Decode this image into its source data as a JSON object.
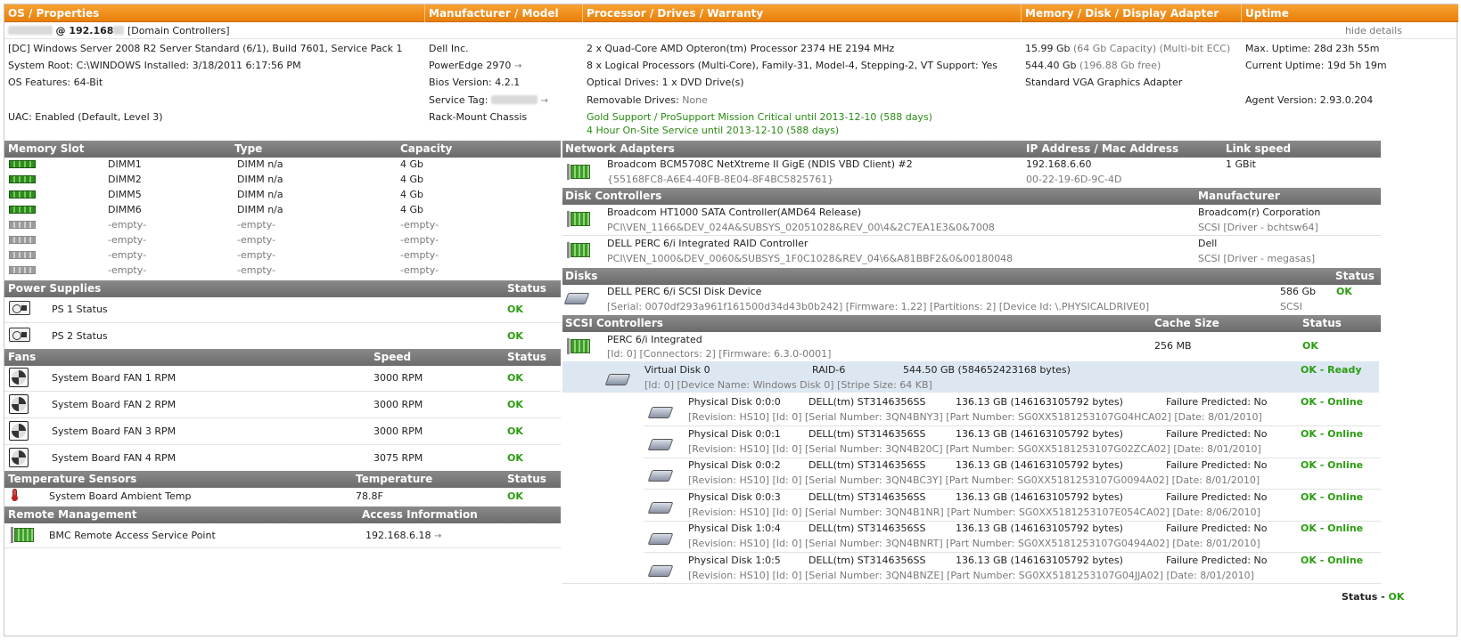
{
  "header": {
    "col1": "OS / Properties",
    "col2": "Manufacturer / Model",
    "col3": "Processor / Drives / Warranty",
    "col4": "Memory / Disk / Display Adapter",
    "col5": "Uptime"
  },
  "host": {
    "ip_prefix": "@ 192.168",
    "role": "[Domain Controllers]",
    "hide_details": "hide details"
  },
  "os": {
    "line1": "[DC] Windows Server 2008 R2 Server Standard (6/1), Build 7601, Service Pack 1",
    "line2": "System Root: C:\\WINDOWS  Installed: 3/18/2011 6:17:56 PM",
    "line3": "OS Features: 64-Bit",
    "line4": "UAC: Enabled (Default, Level 3)"
  },
  "manufacturer": {
    "vendor": "Dell Inc.",
    "model": "PowerEdge 2970",
    "bios": "Bios Version: 4.2.1",
    "service_tag_label": "Service Tag:",
    "chassis": "Rack-Mount Chassis"
  },
  "processor": {
    "cpu": "2 x Quad-Core AMD Opteron(tm) Processor 2374 HE 2194 MHz",
    "logical": "8 x Logical Processors (Multi-Core), Family-31, Model-4, Stepping-2, VT Support: Yes",
    "optical": "Optical Drives: 1 x DVD Drive(s)",
    "removable_label": "Removable Drives:",
    "removable_value": "None",
    "warranty1": "Gold Support / ProSupport Mission Critical until 2013-12-10 (588 days)",
    "warranty2": "4 Hour On-Site Service until 2013-12-10 (588 days)"
  },
  "memory": {
    "ram": "15.99 Gb",
    "ram_detail": "(64 Gb Capacity) (Multi-bit ECC)",
    "disk": "544.40 Gb",
    "disk_detail": "(196.88 Gb free)",
    "display": "Standard VGA Graphics Adapter"
  },
  "uptime": {
    "max": "Max. Uptime: 28d 23h 55m",
    "current": "Current Uptime: 19d 5h 19m",
    "agent": "Agent Version: 2.93.0.204"
  },
  "memory_slots": {
    "headers": [
      "Memory Slot",
      "Type",
      "Capacity"
    ],
    "rows": [
      {
        "slot": "DIMM1",
        "type": "DIMM n/a",
        "capacity": "4 Gb"
      },
      {
        "slot": "DIMM2",
        "type": "DIMM n/a",
        "capacity": "4 Gb"
      },
      {
        "slot": "DIMM5",
        "type": "DIMM n/a",
        "capacity": "4 Gb"
      },
      {
        "slot": "DIMM6",
        "type": "DIMM n/a",
        "capacity": "4 Gb"
      },
      {
        "slot": "-empty-",
        "type": "-empty-",
        "capacity": "-empty-"
      },
      {
        "slot": "-empty-",
        "type": "-empty-",
        "capacity": "-empty-"
      },
      {
        "slot": "-empty-",
        "type": "-empty-",
        "capacity": "-empty-"
      },
      {
        "slot": "-empty-",
        "type": "-empty-",
        "capacity": "-empty-"
      }
    ]
  },
  "power": {
    "headers": [
      "Power Supplies",
      "Status"
    ],
    "rows": [
      {
        "name": "PS 1 Status",
        "status": "OK"
      },
      {
        "name": "PS 2 Status",
        "status": "OK"
      }
    ]
  },
  "fans": {
    "headers": [
      "Fans",
      "Speed",
      "Status"
    ],
    "rows": [
      {
        "name": "System Board FAN 1 RPM",
        "speed": "3000 RPM",
        "status": "OK"
      },
      {
        "name": "System Board FAN 2 RPM",
        "speed": "3000 RPM",
        "status": "OK"
      },
      {
        "name": "System Board FAN 3 RPM",
        "speed": "3000 RPM",
        "status": "OK"
      },
      {
        "name": "System Board FAN 4 RPM",
        "speed": "3075 RPM",
        "status": "OK"
      }
    ]
  },
  "temperature": {
    "headers": [
      "Temperature Sensors",
      "Temperature",
      "Status"
    ],
    "rows": [
      {
        "name": "System Board Ambient Temp",
        "temp": "78.8F",
        "status": "OK"
      }
    ]
  },
  "remote": {
    "headers": [
      "Remote Management",
      "Access Information"
    ],
    "rows": [
      {
        "name": "BMC Remote Access Service Point",
        "access": "192.168.6.18"
      }
    ]
  },
  "network": {
    "headers": [
      "Network Adapters",
      "IP Address / Mac Address",
      "Link speed"
    ],
    "rows": [
      {
        "name": "Broadcom BCM5708C NetXtreme II GigE (NDIS VBD Client) #2",
        "guid": "{55168FC8-A6E4-40FB-8E04-8F4BC5825761}",
        "ip": "192.168.6.60",
        "mac": "00-22-19-6D-9C-4D",
        "speed": "1 GBit"
      }
    ]
  },
  "disk_controllers": {
    "headers": [
      "Disk Controllers",
      "Manufacturer"
    ],
    "rows": [
      {
        "name": "Broadcom HT1000 SATA Controller(AMD64 Release)",
        "pnp": "PCI\\VEN_1166&DEV_024A&SUBSYS_02051028&REV_00\\4&2C7EA1E3&0&7008",
        "mfr": "Broadcom(r) Corporation",
        "driver": "SCSI [Driver - bchtsw64]"
      },
      {
        "name": "DELL PERC 6/i Integrated RAID Controller",
        "pnp": "PCI\\VEN_1000&DEV_0060&SUBSYS_1F0C1028&REV_04\\6&A81BBF2&0&00180048",
        "mfr": "Dell",
        "driver": "SCSI [Driver - megasas]"
      }
    ]
  },
  "disks": {
    "headers": [
      "Disks",
      "Status"
    ],
    "rows": [
      {
        "name": "DELL PERC 6/i SCSI Disk Device",
        "detail": "[Serial: 0070df293a961f161500d34d43b0b242]  [Firmware: 1.22]  [Partitions: 2]  [Device Id: \\.PHYSICALDRIVE0]",
        "size": "586 Gb",
        "iface": "SCSI",
        "status": "OK"
      }
    ]
  },
  "scsi": {
    "headers": [
      "SCSI Controllers",
      "Cache Size",
      "Status"
    ],
    "controller": {
      "name": "PERC 6/i Integrated",
      "detail": "[Id: 0] [Connectors: 2] [Firmware: 6.3.0-0001]",
      "cache": "256 MB",
      "status": "OK"
    },
    "virtual_disk": {
      "name": "Virtual Disk 0",
      "raid": "RAID-6",
      "size": "544.50 GB (584652423168 bytes)",
      "detail": "[Id: 0] [Device Name: Windows Disk 0] [Stripe Size: 64 KB]",
      "status": "OK - Ready"
    },
    "physical": [
      {
        "name": "Physical Disk 0:0:0",
        "model": "DELL(tm) ST3146356SS",
        "size": "136.13 GB (146163105792 bytes)",
        "predict": "Failure Predicted: No",
        "status": "OK - Online",
        "detail": "[Revision: HS10] [Id: 0] [Serial Number: 3QN4BNY3] [Part Number: SG0XX5181253107G04HCA02] [Date: 8/01/2010]"
      },
      {
        "name": "Physical Disk 0:0:1",
        "model": "DELL(tm) ST3146356SS",
        "size": "136.13 GB (146163105792 bytes)",
        "predict": "Failure Predicted: No",
        "status": "OK - Online",
        "detail": "[Revision: HS10] [Id: 0] [Serial Number: 3QN4B20C] [Part Number: SG0XX5181253107G02ZCA02] [Date: 8/01/2010]"
      },
      {
        "name": "Physical Disk 0:0:2",
        "model": "DELL(tm) ST3146356SS",
        "size": "136.13 GB (146163105792 bytes)",
        "predict": "Failure Predicted: No",
        "status": "OK - Online",
        "detail": "[Revision: HS10] [Id: 0] [Serial Number: 3QN4BC3Y] [Part Number: SG0XX5181253107G0094A02] [Date: 8/01/2010]"
      },
      {
        "name": "Physical Disk 0:0:3",
        "model": "DELL(tm) ST3146356SS",
        "size": "136.13 GB (146163105792 bytes)",
        "predict": "Failure Predicted: No",
        "status": "OK - Online",
        "detail": "[Revision: HS10] [Id: 0] [Serial Number: 3QN4B1NR] [Part Number: SG0XX5181253107E054CA02] [Date: 8/06/2010]"
      },
      {
        "name": "Physical Disk 1:0:4",
        "model": "DELL(tm) ST3146356SS",
        "size": "136.13 GB (146163105792 bytes)",
        "predict": "Failure Predicted: No",
        "status": "OK - Online",
        "detail": "[Revision: HS10] [Id: 0] [Serial Number: 3QN4BNRT] [Part Number: SG0XX5181253107G0494A02] [Date: 8/01/2010]"
      },
      {
        "name": "Physical Disk 1:0:5",
        "model": "DELL(tm) ST3146356SS",
        "size": "136.13 GB (146163105792 bytes)",
        "predict": "Failure Predicted: No",
        "status": "OK - Online",
        "detail": "[Revision: HS10] [Id: 0] [Serial Number: 3QN4BNZE] [Part Number: SG0XX5181253107G04JJA02] [Date: 8/01/2010]"
      }
    ]
  },
  "footer": {
    "label": "Status - ",
    "value": "OK"
  }
}
